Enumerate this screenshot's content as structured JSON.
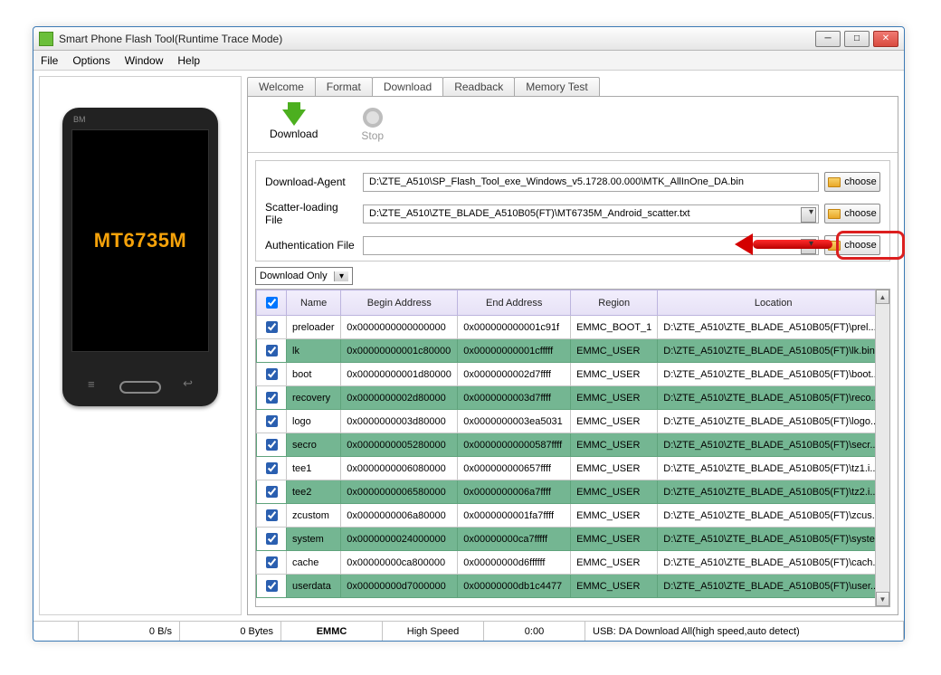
{
  "window": {
    "title": "Smart Phone Flash Tool(Runtime Trace Mode)"
  },
  "menu": {
    "file": "File",
    "options": "Options",
    "window": "Window",
    "help": "Help"
  },
  "phone_text": "MT6735M",
  "phone_brand": "BM",
  "tabs": {
    "welcome": "Welcome",
    "format": "Format",
    "download": "Download",
    "readback": "Readback",
    "memory": "Memory Test"
  },
  "toolbar": {
    "download": "Download",
    "stop": "Stop"
  },
  "fields": {
    "agent_label": "Download-Agent",
    "agent_value": "D:\\ZTE_A510\\SP_Flash_Tool_exe_Windows_v5.1728.00.000\\MTK_AllInOne_DA.bin",
    "scatter_label": "Scatter-loading File",
    "scatter_value": "D:\\ZTE_A510\\ZTE_BLADE_A510B05(FT)\\MT6735M_Android_scatter.txt",
    "auth_label": "Authentication File",
    "auth_value": "",
    "choose": "choose",
    "mode": "Download Only"
  },
  "table": {
    "headers": {
      "chk": "✔",
      "name": "Name",
      "begin": "Begin Address",
      "end": "End Address",
      "region": "Region",
      "location": "Location"
    },
    "rows": [
      {
        "name": "preloader",
        "begin": "0x0000000000000000",
        "end": "0x000000000001c91f",
        "region": "EMMC_BOOT_1",
        "loc": "D:\\ZTE_A510\\ZTE_BLADE_A510B05(FT)\\prel..."
      },
      {
        "name": "lk",
        "begin": "0x00000000001c80000",
        "end": "0x00000000001cfffff",
        "region": "EMMC_USER",
        "loc": "D:\\ZTE_A510\\ZTE_BLADE_A510B05(FT)\\lk.bin"
      },
      {
        "name": "boot",
        "begin": "0x00000000001d80000",
        "end": "0x0000000002d7ffff",
        "region": "EMMC_USER",
        "loc": "D:\\ZTE_A510\\ZTE_BLADE_A510B05(FT)\\boot..."
      },
      {
        "name": "recovery",
        "begin": "0x0000000002d80000",
        "end": "0x0000000003d7ffff",
        "region": "EMMC_USER",
        "loc": "D:\\ZTE_A510\\ZTE_BLADE_A510B05(FT)\\reco..."
      },
      {
        "name": "logo",
        "begin": "0x0000000003d80000",
        "end": "0x0000000003ea5031",
        "region": "EMMC_USER",
        "loc": "D:\\ZTE_A510\\ZTE_BLADE_A510B05(FT)\\logo..."
      },
      {
        "name": "secro",
        "begin": "0x0000000005280000",
        "end": "0x00000000000587ffff",
        "region": "EMMC_USER",
        "loc": "D:\\ZTE_A510\\ZTE_BLADE_A510B05(FT)\\secr..."
      },
      {
        "name": "tee1",
        "begin": "0x0000000006080000",
        "end": "0x000000000657ffff",
        "region": "EMMC_USER",
        "loc": "D:\\ZTE_A510\\ZTE_BLADE_A510B05(FT)\\tz1.i..."
      },
      {
        "name": "tee2",
        "begin": "0x0000000006580000",
        "end": "0x0000000006a7ffff",
        "region": "EMMC_USER",
        "loc": "D:\\ZTE_A510\\ZTE_BLADE_A510B05(FT)\\tz2.i..."
      },
      {
        "name": "zcustom",
        "begin": "0x0000000006a80000",
        "end": "0x0000000001fa7ffff",
        "region": "EMMC_USER",
        "loc": "D:\\ZTE_A510\\ZTE_BLADE_A510B05(FT)\\zcus..."
      },
      {
        "name": "system",
        "begin": "0x0000000024000000",
        "end": "0x00000000ca7fffff",
        "region": "EMMC_USER",
        "loc": "D:\\ZTE_A510\\ZTE_BLADE_A510B05(FT)\\syste..."
      },
      {
        "name": "cache",
        "begin": "0x00000000ca800000",
        "end": "0x00000000d6ffffff",
        "region": "EMMC_USER",
        "loc": "D:\\ZTE_A510\\ZTE_BLADE_A510B05(FT)\\cach..."
      },
      {
        "name": "userdata",
        "begin": "0x00000000d7000000",
        "end": "0x00000000db1c4477",
        "region": "EMMC_USER",
        "loc": "D:\\ZTE_A510\\ZTE_BLADE_A510B05(FT)\\user..."
      }
    ]
  },
  "status": {
    "bps": "0 B/s",
    "bytes": "0 Bytes",
    "storage": "EMMC",
    "speed": "High Speed",
    "time": "0:00",
    "usb": "USB: DA Download All(high speed,auto detect)"
  }
}
